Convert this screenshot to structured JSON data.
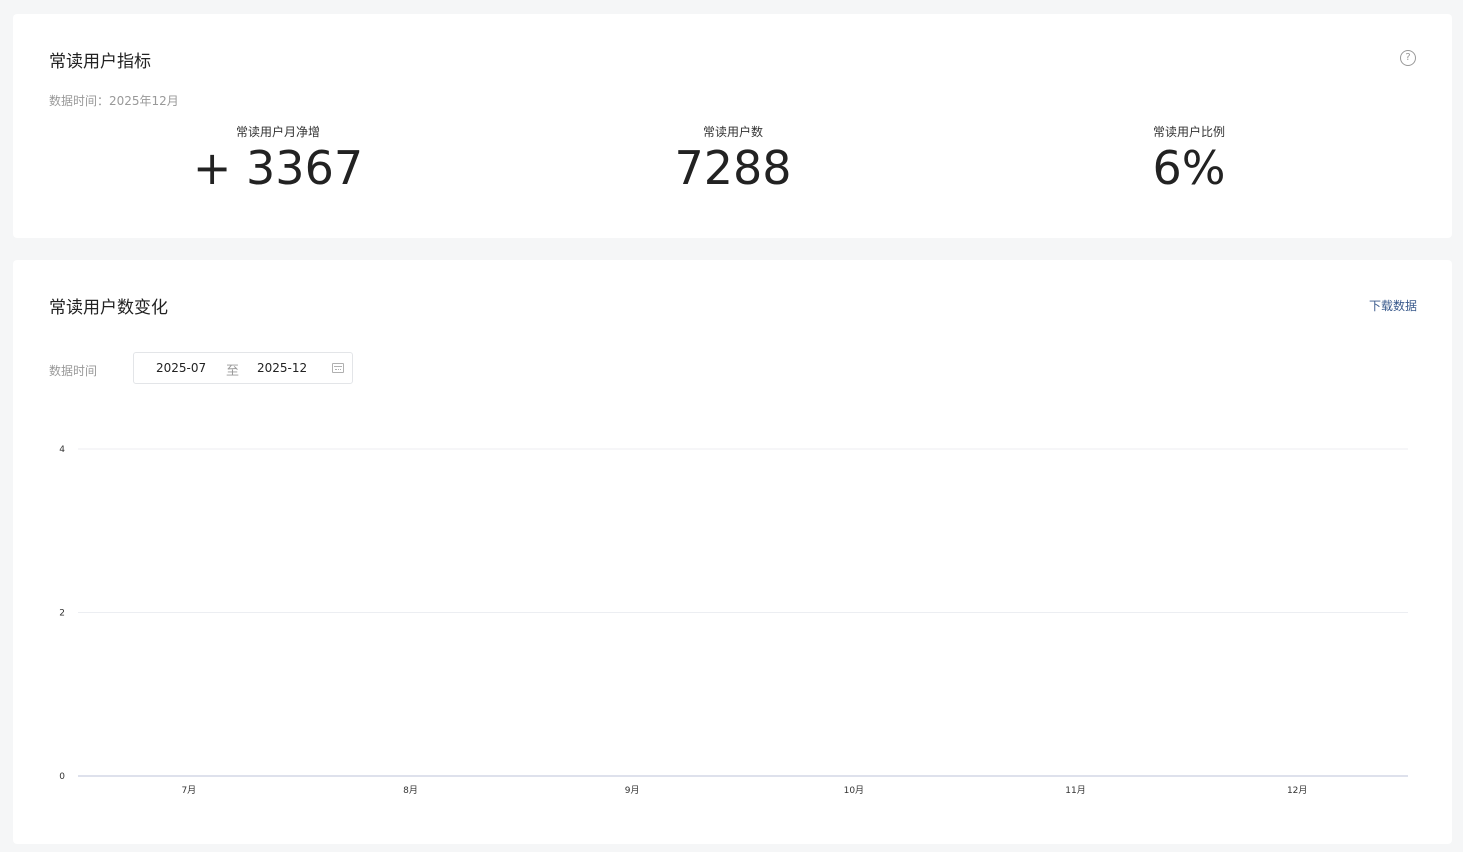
{
  "metrics_card": {
    "title": "常读用户指标",
    "help_icon": "question-circle-icon",
    "data_time": "数据时间：2025年12月",
    "metrics": [
      {
        "label": "常读用户月净增",
        "value": "+ 3367"
      },
      {
        "label": "常读用户数",
        "value": "7288"
      },
      {
        "label": "常读用户比例",
        "value": "6%"
      }
    ]
  },
  "chart_card": {
    "title": "常读用户数变化",
    "download_label": "下载数据",
    "range_label": "数据时间",
    "range_start": "2025-07",
    "range_separator": "至",
    "range_end": "2025-12",
    "calendar_icon": "calendar-icon"
  },
  "chart_data": {
    "type": "line",
    "categories": [
      "7月",
      "8月",
      "9月",
      "10月",
      "11月",
      "12月"
    ],
    "series": [],
    "yticks": [
      0,
      2,
      4
    ],
    "ylim": [
      0,
      4
    ],
    "grid": true,
    "title": "",
    "xlabel": "",
    "ylabel": ""
  }
}
